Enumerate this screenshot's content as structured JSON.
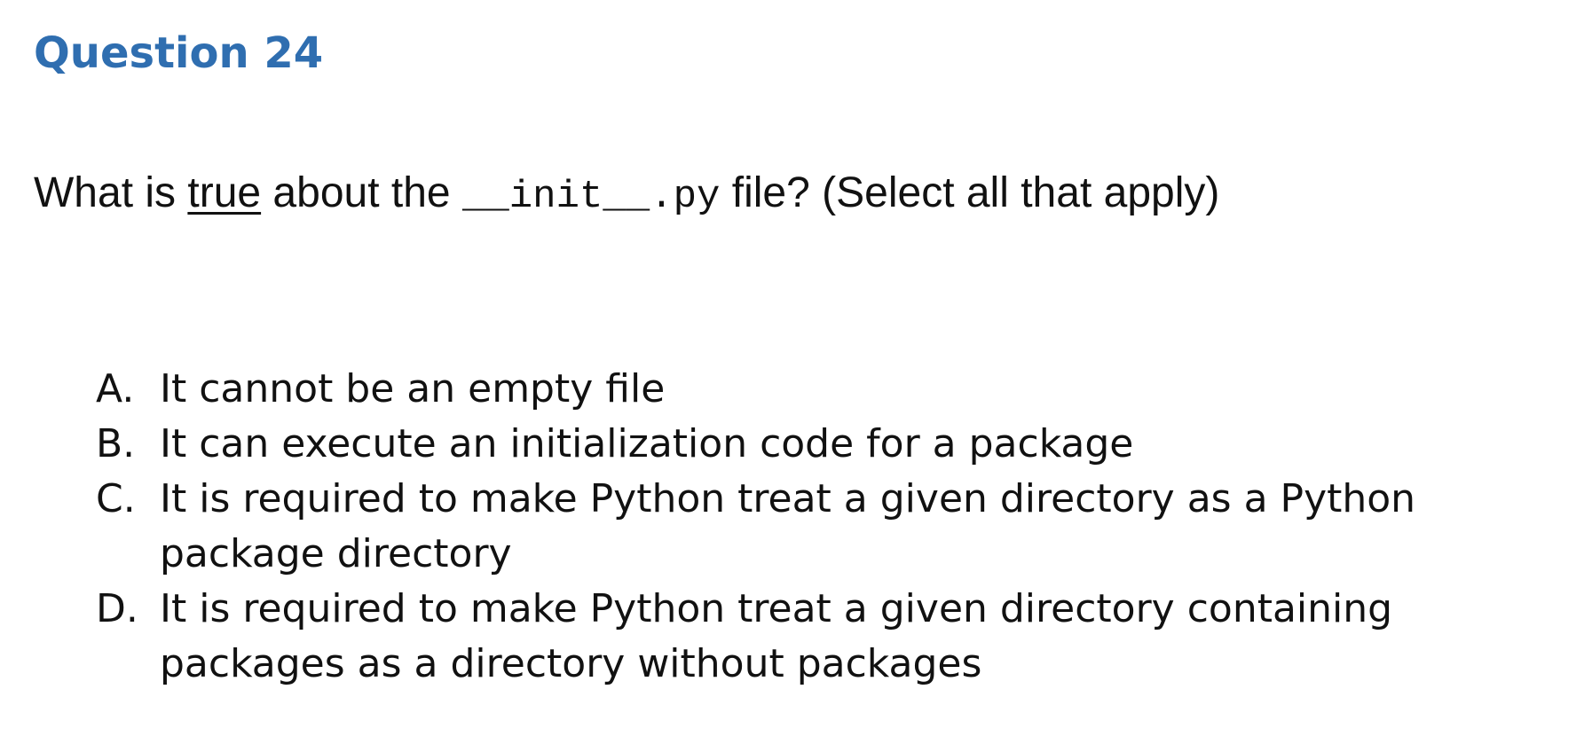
{
  "question": {
    "title": "Question 24",
    "prompt": {
      "before": "What is ",
      "emphasis": "true",
      "middle": " about the ",
      "code": "__init__.py",
      "after": " file? (Select all that apply)"
    }
  },
  "options": [
    {
      "letter": "A.",
      "text": "It cannot be an empty file"
    },
    {
      "letter": "B.",
      "text": "It can execute an initialization code for a package"
    },
    {
      "letter": "C.",
      "text": "It is required to make Python treat a given directory as a Python package directory"
    },
    {
      "letter": "D.",
      "text": "It is required to make Python treat a given directory containing packages as a directory without packages"
    }
  ],
  "colors": {
    "title": "#2f6eb0",
    "text": "#111111",
    "background": "#ffffff"
  }
}
